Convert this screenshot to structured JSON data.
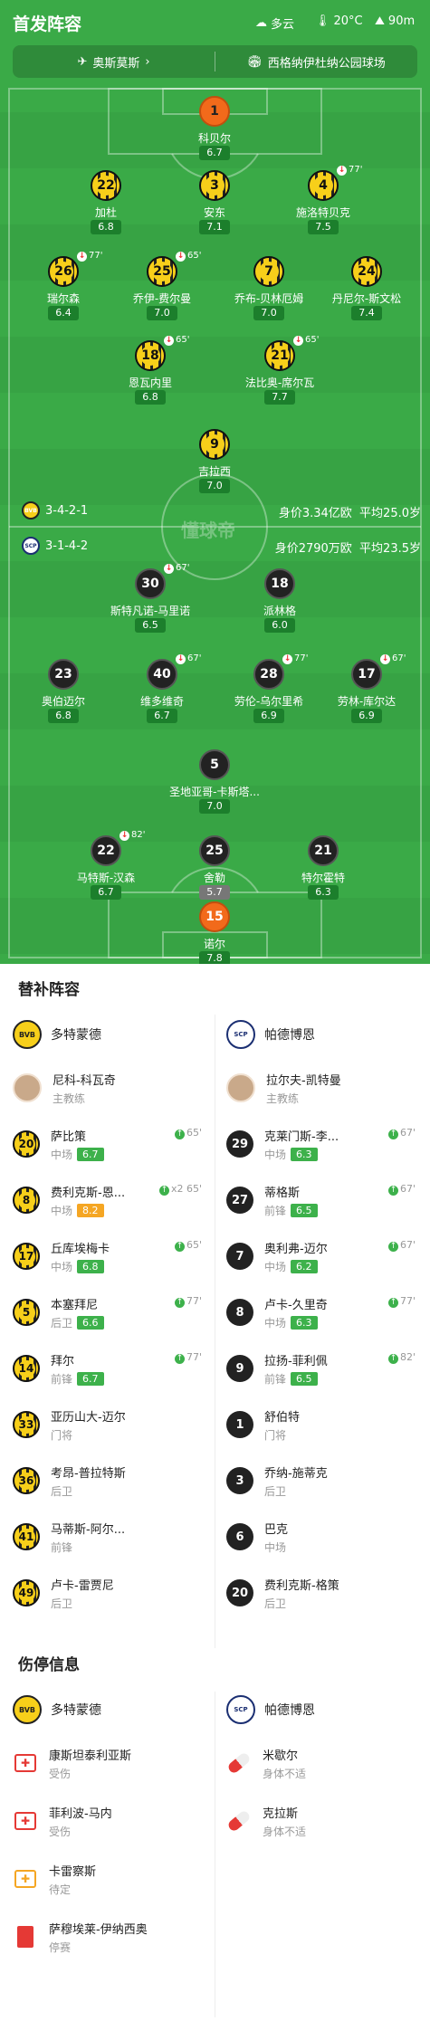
{
  "header": {
    "title": "首发阵容",
    "weather": "多云",
    "temperature": "20°C",
    "altitude": "90m",
    "opponent_label": "奥斯莫斯",
    "stadium": "西格纳伊杜纳公园球场"
  },
  "colors": {
    "pitch": "#3aaa47",
    "rating_green": "#1c7f2c",
    "gk": "#f26a1b",
    "bvb_yellow": "#f7cf1a"
  },
  "dortmund_lineup": {
    "formation": "3-4-2-1",
    "value_label": "身价3.34亿欧",
    "age_label": "平均25.0岁",
    "players": [
      {
        "num": "1",
        "name": "科贝尔",
        "rating": "6.7"
      },
      {
        "num": "22",
        "name": "加杜",
        "rating": "6.8"
      },
      {
        "num": "3",
        "name": "安东",
        "rating": "7.1"
      },
      {
        "num": "4",
        "name": "施洛特贝克",
        "rating": "7.5",
        "sub": "77'"
      },
      {
        "num": "26",
        "name": "瑞尔森",
        "rating": "6.4",
        "sub": "77'"
      },
      {
        "num": "25",
        "name": "乔伊-费尔曼",
        "rating": "7.0",
        "sub": "65'"
      },
      {
        "num": "7",
        "name": "乔布-贝林厄姆",
        "rating": "7.0"
      },
      {
        "num": "24",
        "name": "丹尼尔-斯文松",
        "rating": "7.4"
      },
      {
        "num": "18",
        "name": "恩瓦内里",
        "rating": "6.8",
        "sub": "65'"
      },
      {
        "num": "21",
        "name": "法比奥-席尔瓦",
        "rating": "7.7",
        "sub": "65'"
      },
      {
        "num": "9",
        "name": "吉拉西",
        "rating": "7.0"
      }
    ]
  },
  "paderborn_lineup": {
    "formation": "3-1-4-2",
    "value_label": "身价2790万欧",
    "age_label": "平均23.5岁",
    "players": [
      {
        "num": "30",
        "name": "斯特凡诺-马里诺",
        "rating": "6.5",
        "sub": "67'"
      },
      {
        "num": "18",
        "name": "派林格",
        "rating": "6.0"
      },
      {
        "num": "23",
        "name": "奥伯迈尔",
        "rating": "6.8"
      },
      {
        "num": "40",
        "name": "维多维奇",
        "rating": "6.7",
        "sub": "67'"
      },
      {
        "num": "28",
        "name": "劳伦-乌尔里希",
        "rating": "6.9",
        "sub": "77'"
      },
      {
        "num": "17",
        "name": "劳林-库尔达",
        "rating": "6.9",
        "sub": "67'"
      },
      {
        "num": "5",
        "name": "圣地亚哥-卡斯塔...",
        "rating": "7.0"
      },
      {
        "num": "22",
        "name": "马特斯-汉森",
        "rating": "6.7",
        "sub": "82'"
      },
      {
        "num": "25",
        "name": "舍勒",
        "rating": "5.7"
      },
      {
        "num": "21",
        "name": "特尔霍特",
        "rating": "6.3"
      },
      {
        "num": "15",
        "name": "诺尔",
        "rating": "7.8"
      }
    ]
  },
  "watermark": "懂球帝",
  "subs": {
    "title": "替补阵容",
    "home_team": "多特蒙德",
    "away_team": "帕德博恩",
    "home": [
      {
        "num": "",
        "name": "尼科-科瓦奇",
        "pos": "主教练",
        "rating": "",
        "meta": ""
      },
      {
        "num": "20",
        "name": "萨比策",
        "pos": "中场",
        "rating": "6.7",
        "meta": "65'"
      },
      {
        "num": "8",
        "name": "费利克斯-恩...",
        "pos": "中场",
        "rating": "8.2",
        "meta": "x2 65'"
      },
      {
        "num": "17",
        "name": "丘库埃梅卡",
        "pos": "中场",
        "rating": "6.8",
        "meta": "65'"
      },
      {
        "num": "5",
        "name": "本塞拜尼",
        "pos": "后卫",
        "rating": "6.6",
        "meta": "77'"
      },
      {
        "num": "14",
        "name": "拜尔",
        "pos": "前锋",
        "rating": "6.7",
        "meta": "77'"
      },
      {
        "num": "33",
        "name": "亚历山大-迈尔",
        "pos": "门将",
        "rating": "",
        "meta": ""
      },
      {
        "num": "36",
        "name": "考昂-普拉特斯",
        "pos": "后卫",
        "rating": "",
        "meta": ""
      },
      {
        "num": "41",
        "name": "马蒂斯-阿尔...",
        "pos": "前锋",
        "rating": "",
        "meta": ""
      },
      {
        "num": "49",
        "name": "卢卡-雷贾尼",
        "pos": "后卫",
        "rating": "",
        "meta": ""
      }
    ],
    "away": [
      {
        "num": "",
        "name": "拉尔夫-凯特曼",
        "pos": "主教练",
        "rating": "",
        "meta": ""
      },
      {
        "num": "29",
        "name": "克莱门斯-李...",
        "pos": "中场",
        "rating": "6.3",
        "meta": "67'"
      },
      {
        "num": "27",
        "name": "蒂格斯",
        "pos": "前锋",
        "rating": "6.5",
        "meta": "67'"
      },
      {
        "num": "7",
        "name": "奥利弗-迈尔",
        "pos": "中场",
        "rating": "6.2",
        "meta": "67'"
      },
      {
        "num": "8",
        "name": "卢卡-久里奇",
        "pos": "中场",
        "rating": "6.3",
        "meta": "77'"
      },
      {
        "num": "9",
        "name": "拉扬-菲利佩",
        "pos": "前锋",
        "rating": "6.5",
        "meta": "82'"
      },
      {
        "num": "1",
        "name": "舒伯特",
        "pos": "门将",
        "rating": "",
        "meta": ""
      },
      {
        "num": "3",
        "name": "乔纳-施蒂克",
        "pos": "后卫",
        "rating": "",
        "meta": ""
      },
      {
        "num": "6",
        "name": "巴克",
        "pos": "中场",
        "rating": "",
        "meta": ""
      },
      {
        "num": "20",
        "name": "费利克斯-格策",
        "pos": "后卫",
        "rating": "",
        "meta": ""
      }
    ]
  },
  "injuries": {
    "title": "伤停信息",
    "home": [
      {
        "name": "康斯坦泰利亚斯",
        "status": "受伤",
        "icon": "medkit-icon"
      },
      {
        "name": "菲利波-马内",
        "status": "受伤",
        "icon": "medkit-icon"
      },
      {
        "name": "卡雷察斯",
        "status": "待定",
        "icon": "medkit-pending-icon"
      },
      {
        "name": "萨穆埃莱-伊纳西奥",
        "status": "停赛",
        "icon": "red-card-icon"
      }
    ],
    "away": [
      {
        "name": "米歇尔",
        "status": "身体不适",
        "icon": "pill-icon"
      },
      {
        "name": "克拉斯",
        "status": "身体不适",
        "icon": "pill-icon"
      }
    ]
  }
}
